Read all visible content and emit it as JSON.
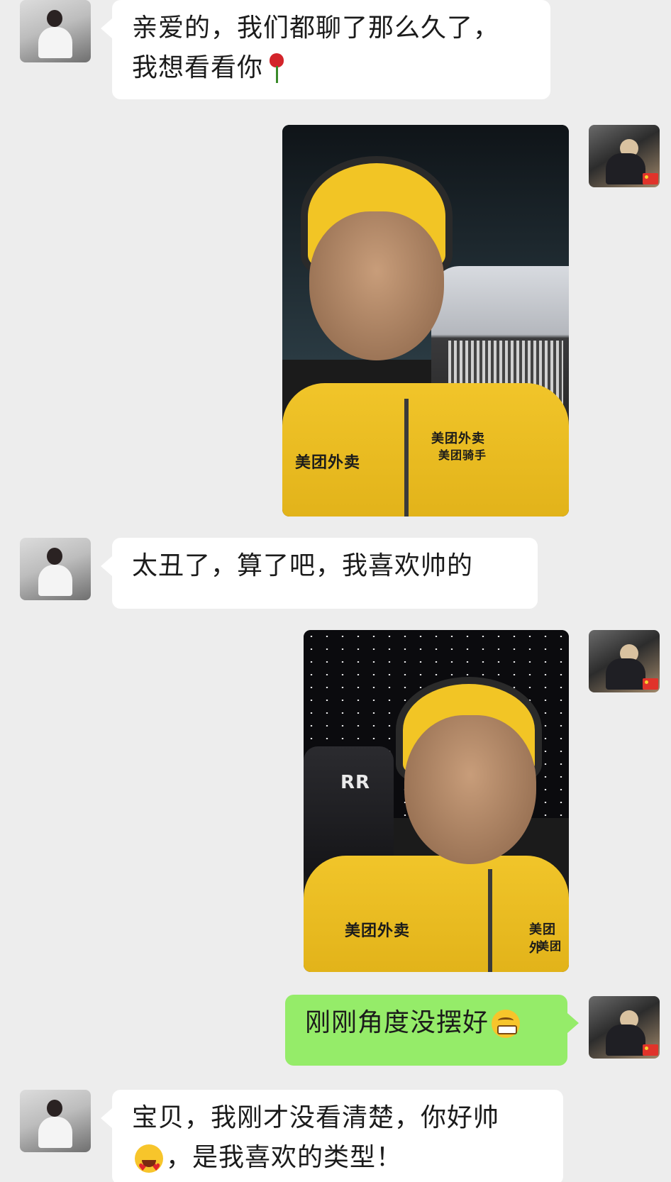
{
  "messages": [
    {
      "side": "left",
      "type": "text",
      "lines": [
        "亲爱的，我们都聊了那么久了，",
        "我想看看你"
      ],
      "emoji": "rose"
    },
    {
      "side": "right",
      "type": "image",
      "image_desc_name": "selfie-with-car",
      "jacket_text": [
        "美团外卖",
        "美团外卖",
        "美团骑手"
      ]
    },
    {
      "side": "left",
      "type": "text",
      "lines": [
        "太丑了，算了吧，我喜欢帅的"
      ]
    },
    {
      "side": "right",
      "type": "image",
      "image_desc_name": "selfie-in-car",
      "jacket_text": [
        "美团外卖",
        "美团外",
        "美团"
      ],
      "seat_logo": "RR"
    },
    {
      "side": "right",
      "type": "text",
      "lines": [
        "刚刚角度没摆好"
      ],
      "emoji": "grinning-face"
    },
    {
      "side": "left",
      "type": "text",
      "lines": [
        "宝贝，我刚才没看清楚，你好帅",
        "，是我喜欢的类型！"
      ],
      "emoji": "heart-eyes-face"
    }
  ],
  "colors": {
    "background": "#ededed",
    "incoming_bubble": "#ffffff",
    "outgoing_bubble": "#95ec69",
    "text": "#1b1b1b"
  }
}
